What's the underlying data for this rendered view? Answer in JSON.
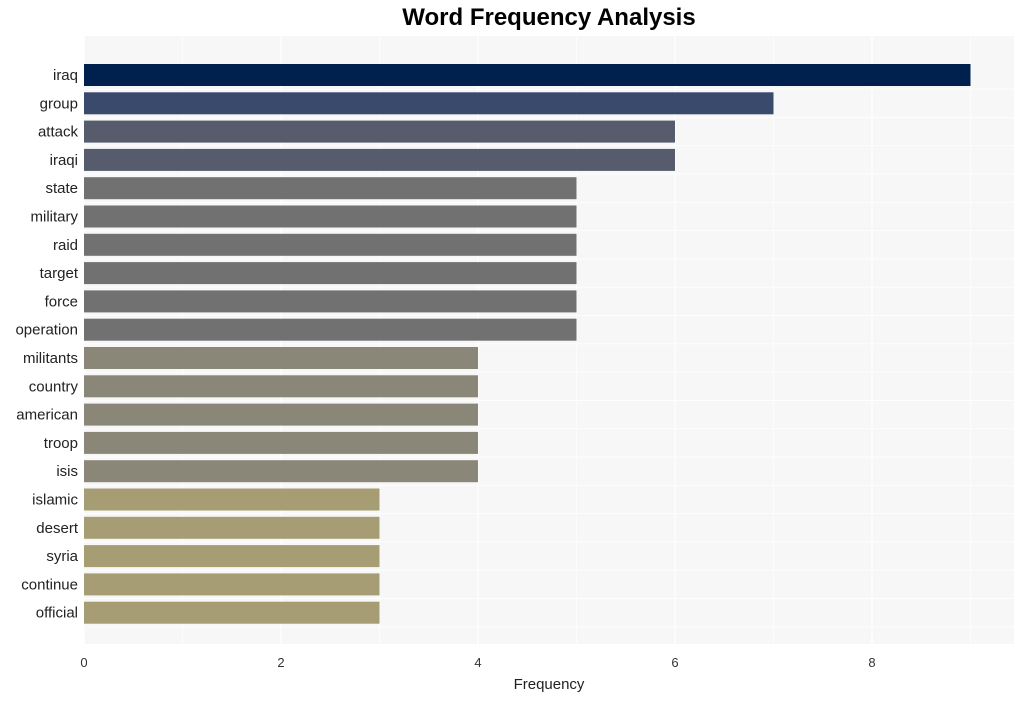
{
  "chart_data": {
    "type": "bar",
    "orientation": "horizontal",
    "title": "Word Frequency Analysis",
    "xlabel": "Frequency",
    "ylabel": "",
    "xlim": [
      0,
      9.45
    ],
    "xticks": [
      0,
      2,
      4,
      6,
      8
    ],
    "grid": true,
    "categories": [
      "iraq",
      "group",
      "attack",
      "iraqi",
      "state",
      "military",
      "raid",
      "target",
      "force",
      "operation",
      "militants",
      "country",
      "american",
      "troop",
      "isis",
      "islamic",
      "desert",
      "syria",
      "continue",
      "official"
    ],
    "values": [
      9,
      7,
      6,
      6,
      5,
      5,
      5,
      5,
      5,
      5,
      4,
      4,
      4,
      4,
      4,
      3,
      3,
      3,
      3,
      3
    ],
    "colors": [
      "#00204e",
      "#3a4a6d",
      "#575c6d",
      "#575c6d",
      "#717171",
      "#717171",
      "#717171",
      "#717171",
      "#717171",
      "#717171",
      "#8a8678",
      "#8a8678",
      "#8a8678",
      "#8a8678",
      "#8a8678",
      "#a69d74",
      "#a69d74",
      "#a69d74",
      "#a69d74",
      "#a69d74"
    ]
  }
}
